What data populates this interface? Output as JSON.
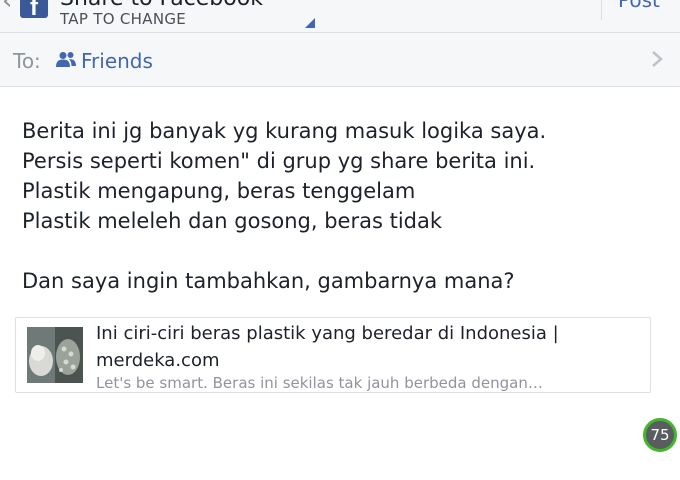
{
  "header": {
    "title": "Share to Facebook",
    "subtitle": "TAP TO CHANGE",
    "post_label": "Post",
    "back_icon": "chevron-left-icon",
    "logo_icon": "facebook-logo-icon"
  },
  "audience": {
    "to_label": "To:",
    "selected": "Friends",
    "icon": "friends-icon"
  },
  "post": {
    "lines": [
      "Berita ini jg banyak yg kurang masuk logika saya.",
      "Persis seperti komen\" di grup yg share berita ini.",
      "Plastik mengapung, beras tenggelam",
      "Plastik meleleh dan gosong, beras tidak",
      "Dan saya ingin tambahkan, gambarnya mana?"
    ]
  },
  "link_preview": {
    "title": "Ini ciri-ciri beras plastik yang beredar di Indonesia | merdeka.com",
    "description": "Let's be smart. Beras ini sekilas tak jauh berbeda dengan…"
  },
  "char_counter": "75",
  "colors": {
    "accent": "#4267b2",
    "header_bg": "#f6f7f9",
    "counter_ring": "#42b72a"
  }
}
